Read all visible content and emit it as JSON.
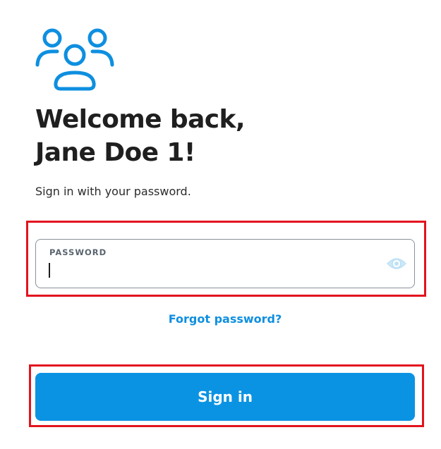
{
  "header": {
    "icon": "users-group-icon",
    "title_line1": "Welcome back,",
    "title_line2": "Jane Doe 1!",
    "subtitle": "Sign in with your password."
  },
  "password_field": {
    "label": "PASSWORD",
    "value": "",
    "placeholder": "",
    "toggle_icon": "eye-icon"
  },
  "links": {
    "forgot_password": "Forgot password?"
  },
  "actions": {
    "sign_in_label": "Sign in"
  },
  "colors": {
    "accent": "#0b93e3",
    "link": "#0e8fe0",
    "highlight": "#e3131e",
    "eye_icon": "#bfe2f5"
  }
}
